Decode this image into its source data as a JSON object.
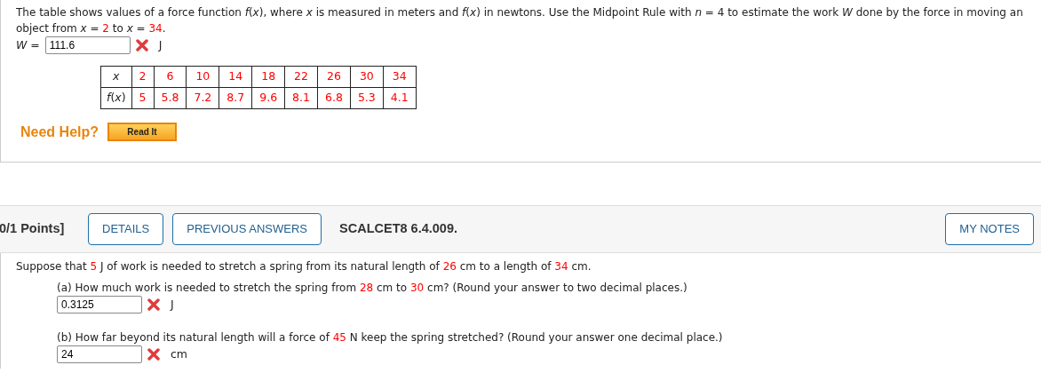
{
  "problem1": {
    "prompt": [
      {
        "kind": "text",
        "text": "The table shows values of a force function *f*(*x*), where *x* is measured in meters and *f*(*x*) in newtons. Use the Midpoint Rule with *n* = 4 to estimate the work *W* done by the force in moving an object from *x* = "
      },
      {
        "kind": "value",
        "text": "2"
      },
      {
        "kind": "text",
        "text": " to *x* = "
      },
      {
        "kind": "value",
        "text": "34"
      },
      {
        "kind": "text",
        "text": "."
      }
    ],
    "answer": {
      "label": "*W* =",
      "value": "111.6",
      "correct": false,
      "unit": "J"
    },
    "table": {
      "rows": [
        {
          "label": "*x*",
          "cells": [
            "2",
            "6",
            "10",
            "14",
            "18",
            "22",
            "26",
            "30",
            "34"
          ]
        },
        {
          "label": "*f*(*x*)",
          "cells": [
            "5",
            "5.8",
            "7.2",
            "8.7",
            "9.6",
            "8.1",
            "6.8",
            "5.3",
            "4.1"
          ]
        }
      ]
    },
    "help": {
      "label": "Need Help?",
      "buttons": [
        "Read It"
      ]
    }
  },
  "problem2": {
    "header": {
      "points": "0/1 Points]",
      "buttons": [
        "DETAILS",
        "PREVIOUS ANSWERS"
      ],
      "title": "SCALCET8 6.4.009.",
      "notes_button": "MY NOTES"
    },
    "prompt": [
      {
        "kind": "text",
        "text": "Suppose that "
      },
      {
        "kind": "value",
        "text": "5"
      },
      {
        "kind": "text",
        "text": " J of work is needed to stretch a spring from its natural length of "
      },
      {
        "kind": "value",
        "text": "26"
      },
      {
        "kind": "text",
        "text": " cm to a length of "
      },
      {
        "kind": "value",
        "text": "34"
      },
      {
        "kind": "text",
        "text": " cm."
      }
    ],
    "parts": [
      {
        "question": [
          {
            "kind": "text",
            "text": "(a) How much work is needed to stretch the spring from "
          },
          {
            "kind": "value",
            "text": "28"
          },
          {
            "kind": "text",
            "text": " cm to "
          },
          {
            "kind": "value",
            "text": "30"
          },
          {
            "kind": "text",
            "text": " cm? (Round your answer to two decimal places.)"
          }
        ],
        "answer": {
          "value": "0.3125",
          "correct": false,
          "unit": "J"
        }
      },
      {
        "question": [
          {
            "kind": "text",
            "text": "(b) How far beyond its natural length will a force of "
          },
          {
            "kind": "value",
            "text": "45"
          },
          {
            "kind": "text",
            "text": " N keep the spring stretched? (Round your answer one decimal place.)"
          }
        ],
        "answer": {
          "value": "24",
          "correct": false,
          "unit": "cm"
        }
      }
    ]
  }
}
